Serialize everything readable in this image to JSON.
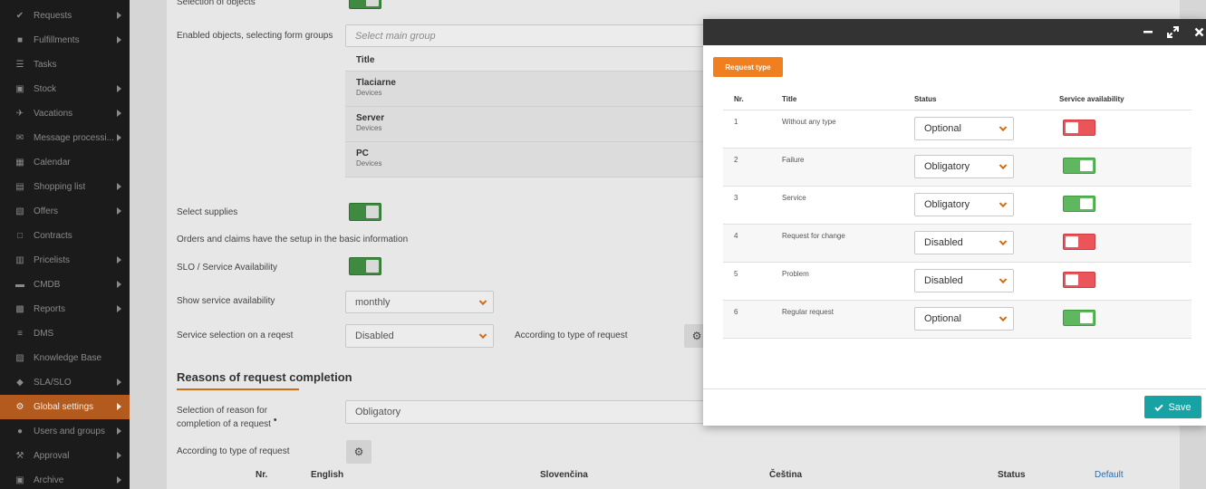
{
  "sidebar": {
    "items": [
      {
        "label": "Requests",
        "icon": "check-circle-icon",
        "glyph": "✔",
        "arrow": true,
        "active": false
      },
      {
        "label": "Fulfillments",
        "icon": "cube-icon",
        "glyph": "■",
        "arrow": true,
        "active": false
      },
      {
        "label": "Tasks",
        "icon": "tasks-icon",
        "glyph": "☰",
        "arrow": false,
        "active": false
      },
      {
        "label": "Stock",
        "icon": "box-icon",
        "glyph": "▣",
        "arrow": true,
        "active": false
      },
      {
        "label": "Vacations",
        "icon": "plane-icon",
        "glyph": "✈",
        "arrow": true,
        "active": false
      },
      {
        "label": "Message processi...",
        "icon": "envelope-icon",
        "glyph": "✉",
        "arrow": true,
        "active": false
      },
      {
        "label": "Calendar",
        "icon": "calendar-icon",
        "glyph": "▦",
        "arrow": false,
        "active": false
      },
      {
        "label": "Shopping list",
        "icon": "cart-icon",
        "glyph": "▤",
        "arrow": true,
        "active": false
      },
      {
        "label": "Offers",
        "icon": "gift-icon",
        "glyph": "▧",
        "arrow": true,
        "active": false
      },
      {
        "label": "Contracts",
        "icon": "document-icon",
        "glyph": "□",
        "arrow": false,
        "active": false
      },
      {
        "label": "Pricelists",
        "icon": "pricelist-icon",
        "glyph": "▥",
        "arrow": true,
        "active": false
      },
      {
        "label": "CMDB",
        "icon": "folder-icon",
        "glyph": "▬",
        "arrow": true,
        "active": false
      },
      {
        "label": "Reports",
        "icon": "reports-icon",
        "glyph": "▩",
        "arrow": true,
        "active": false
      },
      {
        "label": "DMS",
        "icon": "database-icon",
        "glyph": "≡",
        "arrow": false,
        "active": false
      },
      {
        "label": "Knowledge Base",
        "icon": "book-icon",
        "glyph": "▨",
        "arrow": false,
        "active": false
      },
      {
        "label": "SLA/SLO",
        "icon": "gavel-icon",
        "glyph": "◆",
        "arrow": true,
        "active": false
      },
      {
        "label": "Global settings",
        "icon": "cogs-icon",
        "glyph": "⚙",
        "arrow": true,
        "active": true
      },
      {
        "label": "Users and groups",
        "icon": "users-icon",
        "glyph": "●",
        "arrow": true,
        "active": false
      },
      {
        "label": "Approval",
        "icon": "gavel-icon",
        "glyph": "⚒",
        "arrow": true,
        "active": false
      },
      {
        "label": "Archive",
        "icon": "archive-icon",
        "glyph": "▣",
        "arrow": true,
        "active": false
      }
    ]
  },
  "main": {
    "selection_of_objects_label": "Selection of objects",
    "enabled_objects_label": "Enabled objects, selecting form groups",
    "main_group_placeholder": "Select main group",
    "group_table": {
      "header": "Title",
      "rows": [
        {
          "title": "Tlaciarne",
          "subtitle": "Devices"
        },
        {
          "title": "Server",
          "subtitle": "Devices"
        },
        {
          "title": "PC",
          "subtitle": "Devices"
        }
      ]
    },
    "select_supplies_label": "Select supplies",
    "orders_note": "Orders and claims have the setup in the basic information",
    "slo_label": "SLO / Service Availability",
    "show_availability_label": "Show service availability",
    "show_availability_value": "monthly",
    "service_selection_label": "Service selection on a reqest",
    "service_selection_value": "Disabled",
    "according_type_label": "According to type of request",
    "reasons_title": "Reasons of request completion",
    "reason_selection_label": "Selection of reason for completion of a request",
    "required_marker": "•",
    "reason_selection_value": "Obligatory",
    "according_type_label_2": "According to type of request",
    "bottom_table_headers": {
      "nr": "Nr.",
      "english": "English",
      "slovencina": "Slovenčina",
      "cestina": "Čeština",
      "status": "Status",
      "default": "Default"
    }
  },
  "modal": {
    "title_button": "Request type",
    "columns": {
      "nr": "Nr.",
      "title": "Title",
      "status": "Status",
      "availability": "Service availability"
    },
    "rows": [
      {
        "nr": "1",
        "title": "Without any type",
        "status": "Optional",
        "availability": false
      },
      {
        "nr": "2",
        "title": "Failure",
        "status": "Obligatory",
        "availability": true
      },
      {
        "nr": "3",
        "title": "Service",
        "status": "Obligatory",
        "availability": true
      },
      {
        "nr": "4",
        "title": "Request for change",
        "status": "Disabled",
        "availability": false
      },
      {
        "nr": "5",
        "title": "Problem",
        "status": "Disabled",
        "availability": false
      },
      {
        "nr": "6",
        "title": "Regular request",
        "status": "Optional",
        "availability": true
      }
    ],
    "save_label": "Save",
    "colors": {
      "accent": "#f07f1f",
      "save": "#17a2a4",
      "toggle_on": "#5fb85f",
      "toggle_off": "#e9555a"
    }
  }
}
